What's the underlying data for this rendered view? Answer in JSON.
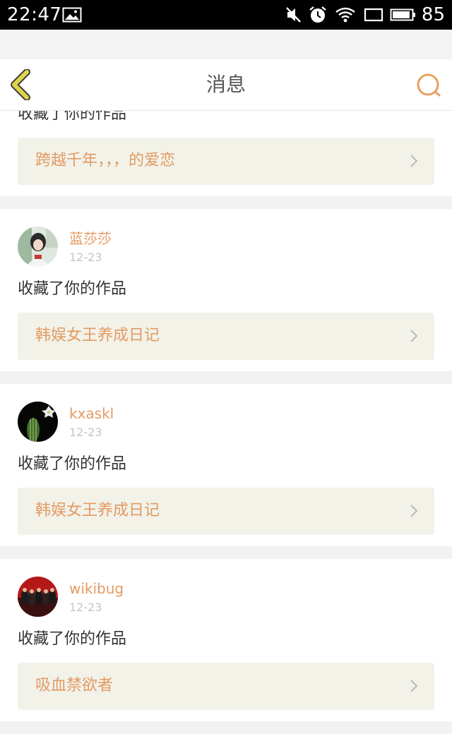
{
  "status_bar": {
    "time": "22:47",
    "battery": "85",
    "icons": [
      "image-icon",
      "mute-icon",
      "alarm-icon",
      "wifi-icon",
      "screen-icon",
      "battery-icon"
    ]
  },
  "header": {
    "title": "消息",
    "back_icon": "chevron-left-icon",
    "search_icon": "search-icon"
  },
  "colors": {
    "accent": "#e39a62",
    "back_arrow": "#dfd44a",
    "link_bg": "#f2f2e9"
  },
  "notifications": [
    {
      "action": "收藏了你的作品",
      "work_title": "跨越千年，，，的爱恋"
    },
    {
      "username": "蓝莎莎",
      "date": "12-23",
      "action": "收藏了你的作品",
      "work_title": "韩娱女王养成日记"
    },
    {
      "username": "kxaskl",
      "date": "12-23",
      "action": "收藏了你的作品",
      "work_title": "韩娱女王养成日记"
    },
    {
      "username": "wikibug",
      "date": "12-23",
      "action": "收藏了你的作品",
      "work_title": "吸血禁欲者"
    }
  ]
}
